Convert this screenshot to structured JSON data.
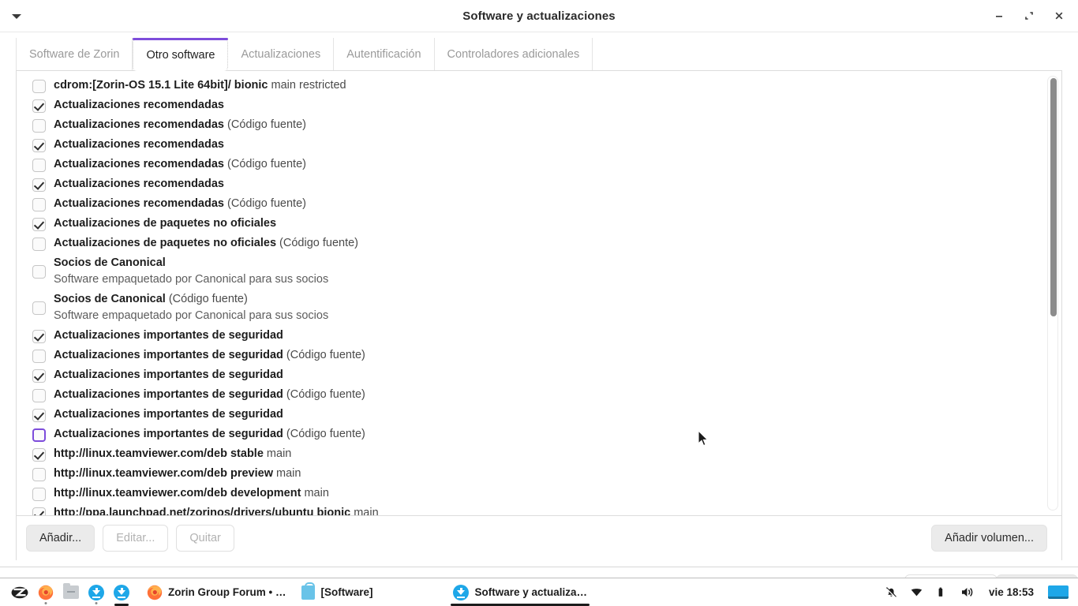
{
  "window": {
    "title": "Software y actualizaciones",
    "menu_icon": "caret-down-icon",
    "controls": {
      "minimize": "minimize-icon",
      "restore": "restore-icon",
      "close": "close-icon"
    }
  },
  "tabs": [
    {
      "label": "Software de Zorin",
      "active": false
    },
    {
      "label": "Otro software",
      "active": true
    },
    {
      "label": "Actualizaciones",
      "active": false
    },
    {
      "label": "Autentificación",
      "active": false
    },
    {
      "label": "Controladores adicionales",
      "active": false
    }
  ],
  "accent_color": "#7d4cdb",
  "list": [
    {
      "checked": false,
      "focused": false,
      "strong": "cdrom:[Zorin-OS 15.1 Lite 64bit]/ bionic",
      "normal": " main restricted",
      "sub": ""
    },
    {
      "checked": true,
      "focused": false,
      "strong": "Actualizaciones recomendadas",
      "normal": "",
      "sub": ""
    },
    {
      "checked": false,
      "focused": false,
      "strong": "Actualizaciones recomendadas",
      "normal": " (Código fuente)",
      "sub": ""
    },
    {
      "checked": true,
      "focused": false,
      "strong": "Actualizaciones recomendadas",
      "normal": "",
      "sub": ""
    },
    {
      "checked": false,
      "focused": false,
      "strong": "Actualizaciones recomendadas",
      "normal": " (Código fuente)",
      "sub": ""
    },
    {
      "checked": true,
      "focused": false,
      "strong": "Actualizaciones recomendadas",
      "normal": "",
      "sub": ""
    },
    {
      "checked": false,
      "focused": false,
      "strong": "Actualizaciones recomendadas",
      "normal": " (Código fuente)",
      "sub": ""
    },
    {
      "checked": true,
      "focused": false,
      "strong": "Actualizaciones de paquetes no oficiales",
      "normal": "",
      "sub": ""
    },
    {
      "checked": false,
      "focused": false,
      "strong": "Actualizaciones de paquetes no oficiales",
      "normal": " (Código fuente)",
      "sub": ""
    },
    {
      "checked": false,
      "focused": false,
      "strong": "Socios de Canonical",
      "normal": "",
      "sub": "Software empaquetado por Canonical para sus socios"
    },
    {
      "checked": false,
      "focused": false,
      "strong": "Socios de Canonical",
      "normal": " (Código fuente)",
      "sub": "Software empaquetado por Canonical para sus socios"
    },
    {
      "checked": true,
      "focused": false,
      "strong": "Actualizaciones importantes de seguridad",
      "normal": "",
      "sub": ""
    },
    {
      "checked": false,
      "focused": false,
      "strong": "Actualizaciones importantes de seguridad",
      "normal": " (Código fuente)",
      "sub": ""
    },
    {
      "checked": true,
      "focused": false,
      "strong": "Actualizaciones importantes de seguridad",
      "normal": "",
      "sub": ""
    },
    {
      "checked": false,
      "focused": false,
      "strong": "Actualizaciones importantes de seguridad",
      "normal": " (Código fuente)",
      "sub": ""
    },
    {
      "checked": true,
      "focused": false,
      "strong": "Actualizaciones importantes de seguridad",
      "normal": "",
      "sub": ""
    },
    {
      "checked": false,
      "focused": true,
      "strong": "Actualizaciones importantes de seguridad",
      "normal": " (Código fuente)",
      "sub": ""
    },
    {
      "checked": true,
      "focused": false,
      "strong": "http://linux.teamviewer.com/deb stable",
      "normal": " main",
      "sub": ""
    },
    {
      "checked": false,
      "focused": false,
      "strong": "http://linux.teamviewer.com/deb preview",
      "normal": " main",
      "sub": ""
    },
    {
      "checked": false,
      "focused": false,
      "strong": "http://linux.teamviewer.com/deb development",
      "normal": " main",
      "sub": ""
    },
    {
      "checked": true,
      "focused": false,
      "strong": "http://ppa.launchpad.net/zorinos/drivers/ubuntu bionic",
      "normal": " main",
      "sub": ""
    }
  ],
  "actions": {
    "add": "Añadir...",
    "edit": "Editar...",
    "remove": "Quitar",
    "add_volume": "Añadir volumen..."
  },
  "taskbar": {
    "launchers": [
      {
        "name": "zorin-menu-icon",
        "type": "zorin"
      },
      {
        "name": "firefox-icon",
        "type": "firefox",
        "dot": true
      },
      {
        "name": "file-manager-icon",
        "type": "folder"
      },
      {
        "name": "software-updater-icon",
        "type": "download",
        "dot": true
      },
      {
        "name": "software-updates-icon",
        "type": "download",
        "underline": true
      }
    ],
    "windows": [
      {
        "icon": "firefox-icon",
        "type": "firefox",
        "label": "Zorin Group Forum • …",
        "active": false
      },
      {
        "icon": "software-store-icon",
        "type": "shop",
        "label": "[Software]",
        "active": false
      },
      {
        "icon": "software-updates-icon",
        "type": "download",
        "label": "Software y actualiza…",
        "active": true
      }
    ],
    "tray": [
      {
        "name": "notifications-muted-icon"
      },
      {
        "name": "wifi-icon"
      },
      {
        "name": "battery-icon"
      },
      {
        "name": "volume-icon"
      }
    ],
    "clock": "vie 18:53",
    "workspace_indicator": "workspace-switcher"
  }
}
